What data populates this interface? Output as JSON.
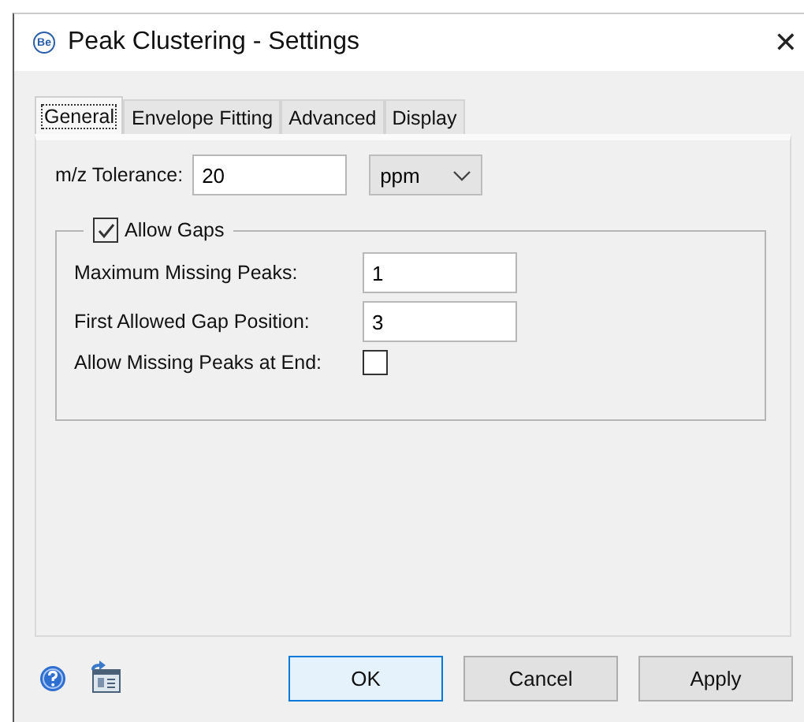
{
  "window": {
    "app_icon_text": "Be",
    "title": "Peak Clustering - Settings",
    "close": "✕"
  },
  "tabs": [
    {
      "label": "General",
      "selected": true
    },
    {
      "label": "Envelope Fitting",
      "selected": false
    },
    {
      "label": "Advanced",
      "selected": false
    },
    {
      "label": "Display",
      "selected": false
    }
  ],
  "tolerance": {
    "label": "m/z Tolerance:",
    "value": "20",
    "unit": "ppm"
  },
  "allow_gaps": {
    "label": "Allow Gaps",
    "checked": true,
    "fields": [
      {
        "kind": "text",
        "label": "Maximum Missing Peaks:",
        "value": "1"
      },
      {
        "kind": "text",
        "label": "First Allowed Gap Position:",
        "value": "3"
      },
      {
        "kind": "checkbox",
        "label": "Allow Missing Peaks at End:",
        "checked": false
      }
    ]
  },
  "buttons": [
    {
      "label": "OK",
      "default": true
    },
    {
      "label": "Cancel",
      "default": false
    },
    {
      "label": "Apply",
      "default": false
    }
  ]
}
